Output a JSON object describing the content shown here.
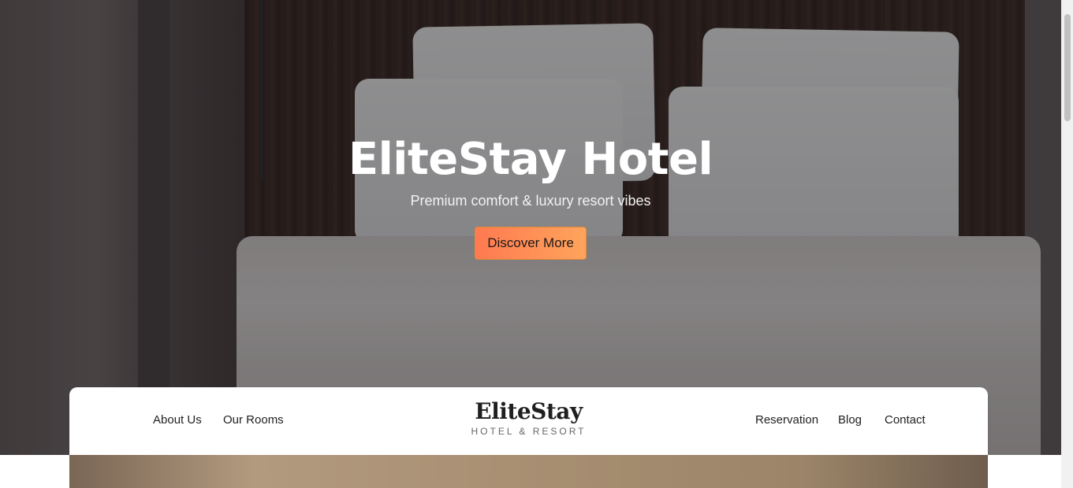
{
  "hero": {
    "title": "EliteStay Hotel",
    "subtitle": "Premium comfort & luxury resort vibes",
    "cta_label": "Discover More"
  },
  "nav": {
    "left_links": [
      "About Us",
      "Our Rooms"
    ],
    "right_links": [
      "Reservation",
      "Blog",
      "Contact"
    ],
    "brand_name": "EliteStay",
    "brand_tagline": "HOTEL & RESORT"
  },
  "colors": {
    "cta_start": "#ff7a50",
    "cta_end": "#ffa45c",
    "nav_bg": "#ffffff"
  }
}
